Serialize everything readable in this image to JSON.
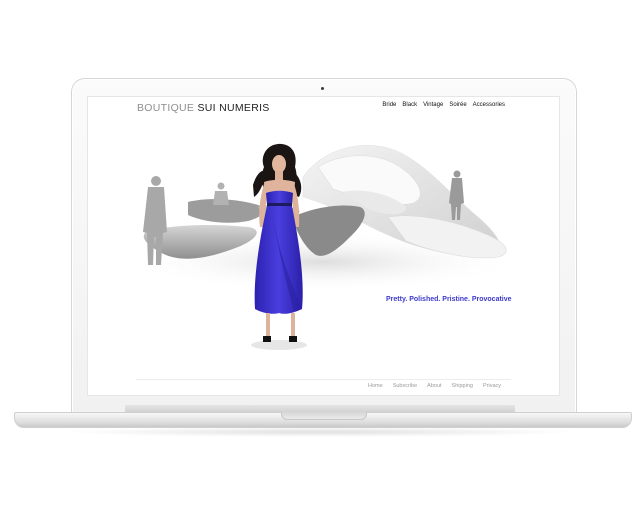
{
  "site": {
    "logo": {
      "part1": "BOUTIQUE",
      "part2": "SUI NUMERIS"
    },
    "nav": [
      "Bride",
      "Black",
      "Vintage",
      "Soirée",
      "Accessories"
    ],
    "tagline": "Pretty. Polished. Pristine. Provocative",
    "footer": [
      "Home",
      "Subscribe",
      "About",
      "Shipping",
      "Privacy"
    ]
  },
  "colors": {
    "accent": "#3d3acb",
    "dress": "#3b2fc9",
    "footer_text": "#9a9a9a",
    "nav_text": "#111111"
  }
}
